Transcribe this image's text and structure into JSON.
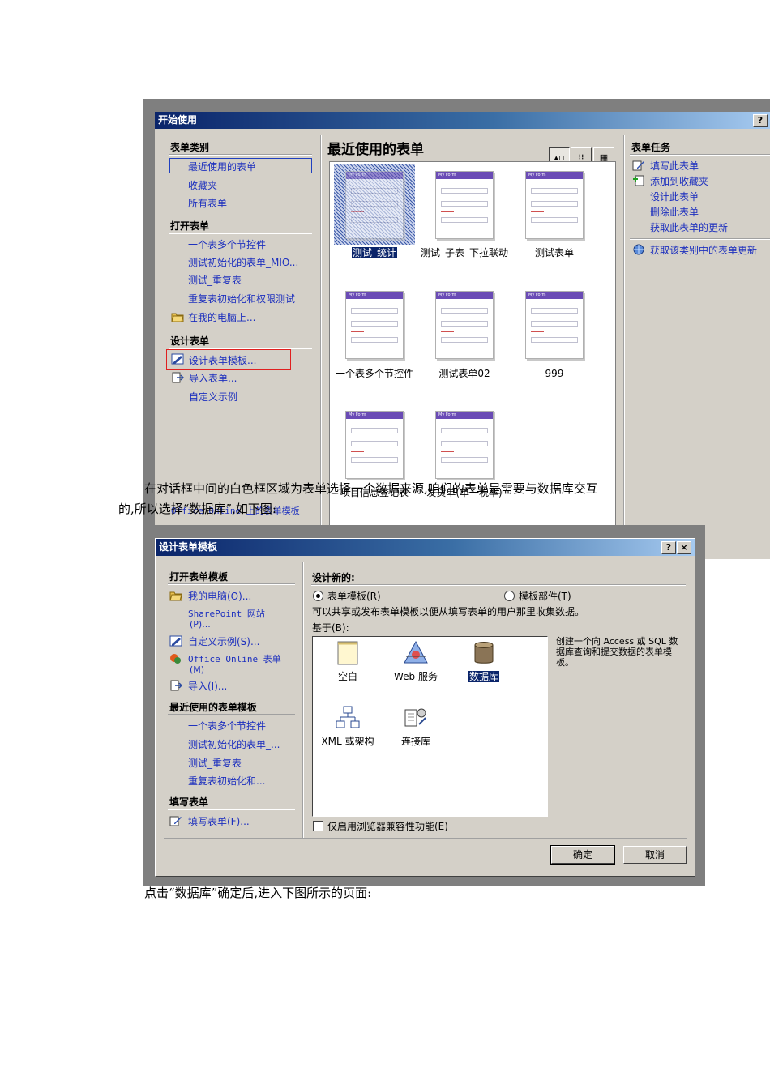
{
  "win1": {
    "title": "开始使用",
    "help": "?",
    "cat_head": "表单类别",
    "cat_items": [
      "最近使用的表单",
      "收藏夹",
      "所有表单"
    ],
    "open_head": "打开表单",
    "open_items": [
      "一个表多个节控件",
      "测试初始化的表单_MIO...",
      "测试_重复表",
      "重复表初始化和权限测试",
      "在我的电脑上..."
    ],
    "design_head": "设计表单",
    "design_items": [
      "设计表单模板...",
      "导入表单...",
      "自定义示例"
    ],
    "gallery_title": "最近使用的表单",
    "forms": [
      "测试_统计",
      "测试_子表_下拉联动",
      "测试表单",
      "一个表多个节控件",
      "测试表单02",
      "999",
      "项目信息登记表",
      "发货单(单一税率)"
    ],
    "thumb_header": "My Form",
    "office_online": "Office Online 上的表单模板",
    "tasks_head": "表单任务",
    "tasks": [
      "填写此表单",
      "添加到收藏夹",
      "设计此表单",
      "删除此表单",
      "获取此表单的更新"
    ],
    "tasks2": [
      "获取该类别中的表单更新"
    ]
  },
  "doc": {
    "para1_line1": "在对话框中间的白色框区域为表单选择一个数据来源,咱们的表单是需要与数据库交互",
    "para1_line2": "的,所以选择“数据库”,如下图:",
    "para2": "点击“数据库”确定后,进入下图所示的页面:"
  },
  "win2": {
    "title": "设计表单模板",
    "help": "?",
    "close": "×",
    "open_head": "打开表单模板",
    "open_items": [
      "我的电脑(O)...",
      "SharePoint 网站",
      "(P)...",
      "自定义示例(S)...",
      "Office Online 表单",
      "(M)",
      "导入(I)..."
    ],
    "recent_head": "最近使用的表单模板",
    "recent_items": [
      "一个表多个节控件",
      "测试初始化的表单_...",
      "测试_重复表",
      "重复表初始化和..."
    ],
    "fill_head": "填写表单",
    "fill_items": [
      "填写表单(F)..."
    ],
    "design_new": "设计新的:",
    "radio_template": "表单模板(R)",
    "radio_part": "模板部件(T)",
    "desc": "可以共享或发布表单模板以便从填写表单的用户那里收集数据。",
    "based_on": "基于(B):",
    "templates": [
      "空白",
      "Web 服务",
      "数据库",
      "XML 或架构",
      "连接库"
    ],
    "template_desc": "创建一个向 Access 或 SQL 数据库查询和提交数据的表单模板。",
    "browser_only": "仅启用浏览器兼容性功能(E)",
    "ok": "确定",
    "cancel": "取消"
  }
}
